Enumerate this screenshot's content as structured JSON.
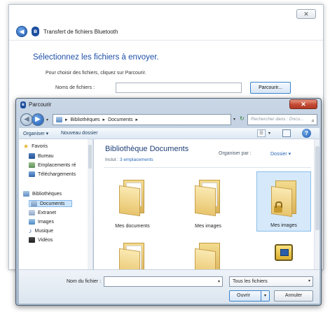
{
  "wizard": {
    "close_glyph": "✕",
    "title": "Transfert de fichiers Bluetooth",
    "heading": "Sélectionnez les fichiers à envoyer.",
    "instruction": "Pour choisir des fichiers, cliquez sur Parcourir.",
    "file_label": "Noms de fichiers :",
    "file_value": "",
    "browse_label": "Parcourir..."
  },
  "dialog": {
    "title": "Parcourir",
    "close_glyph": "✕",
    "breadcrumb": [
      "Bibliothèques",
      "Documents"
    ],
    "search_placeholder": "Rechercher dans : Docu...",
    "toolbar": {
      "organiser": "Organiser ▾",
      "new_folder": "Nouveau dossier"
    },
    "nav": {
      "favorites": "Favoris",
      "desktop": "Bureau",
      "recent_places": "Emplacements ré",
      "downloads": "Téléchargements",
      "libraries": "Bibliothèques",
      "documents": "Documents",
      "extranet": "Extranet",
      "images": "Images",
      "music": "Musique",
      "videos": "Vidéos"
    },
    "content": {
      "title": "Bibliothèque Documents",
      "includes_prefix": "Inclut : ",
      "includes_link": "3 emplacements",
      "arrange_label": "Organiser par :",
      "arrange_value": "Dossier ▾",
      "items": [
        "Mes documents",
        "Mes images",
        "Mes images"
      ]
    },
    "bottom": {
      "filename_label": "Nom du fichier :",
      "filename_value": "",
      "filter": "Tous les fichiers",
      "open": "Ouvrir",
      "cancel": "Annuler"
    }
  },
  "colors": {
    "accent_blue": "#1e4fa8",
    "close_red": "#c24a33",
    "selection": "#d5e9fb",
    "folder": "#e8c56d"
  }
}
